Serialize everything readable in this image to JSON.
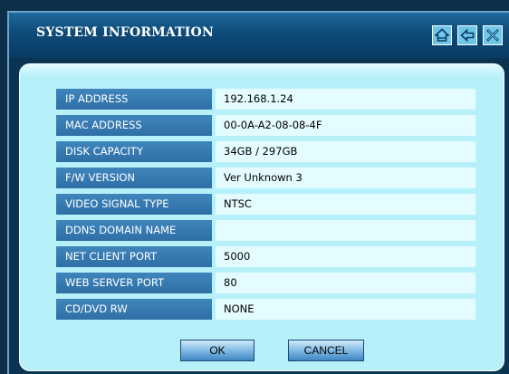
{
  "window": {
    "title": "SYSTEM INFORMATION"
  },
  "titlebar_buttons": [
    {
      "name": "home",
      "icon": "home-icon"
    },
    {
      "name": "back",
      "icon": "back-arrow-icon"
    },
    {
      "name": "close",
      "icon": "close-icon"
    }
  ],
  "info": {
    "rows": [
      {
        "label": "IP ADDRESS",
        "value": "192.168.1.24"
      },
      {
        "label": "MAC ADDRESS",
        "value": "00-0A-A2-08-08-4F"
      },
      {
        "label": "DISK CAPACITY",
        "value": "34GB / 297GB"
      },
      {
        "label": "F/W VERSION",
        "value": "Ver Unknown 3"
      },
      {
        "label": "VIDEO SIGNAL TYPE",
        "value": "NTSC"
      },
      {
        "label": "DDNS DOMAIN NAME",
        "value": ""
      },
      {
        "label": "NET CLIENT PORT",
        "value": "5000"
      },
      {
        "label": "WEB SERVER PORT",
        "value": "80"
      },
      {
        "label": "CD/DVD RW",
        "value": "NONE"
      }
    ]
  },
  "buttons": {
    "ok_label": "OK",
    "cancel_label": "CANCEL"
  },
  "colors": {
    "title_bar": "#0e4a78",
    "panel": "#b6f1fa",
    "label_bg": "#3777b2",
    "value_bg": "#e4fcff",
    "icon_button": "#6fc6e8"
  }
}
